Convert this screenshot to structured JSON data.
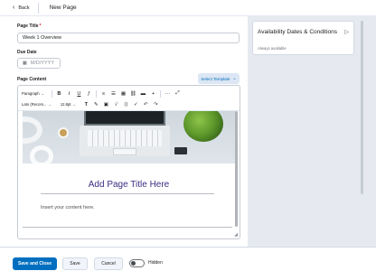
{
  "topbar": {
    "back_label": "Back",
    "back_icon": "chevron-left-icon",
    "page_title": "New Page"
  },
  "form": {
    "title_label": "Page Title",
    "title_required_mark": "*",
    "title_value": "Week 1 Overview",
    "due_label": "Due Date",
    "due_placeholder": "M/D/YYYY",
    "content_label": "Page Content",
    "template_button": "Select Template"
  },
  "toolbar": {
    "paragraph": "Paragraph",
    "font": "Lato (Recom...",
    "size": "12.8pt",
    "icons": [
      "bold-icon",
      "italic-icon",
      "underline-icon",
      "strikethrough-icon",
      "align-icon",
      "list-icon",
      "table-icon",
      "link-icon",
      "media-icon",
      "insert-icon",
      "more-icon",
      "fullscreen-icon",
      "text-color-icon",
      "highlight-icon",
      "image-icon",
      "equation-icon",
      "code-icon",
      "accessibility-icon",
      "undo-icon",
      "redo-icon"
    ]
  },
  "editor": {
    "heading": "Add Page Title Here",
    "body": "Insert your content here."
  },
  "sidebar": {
    "availability_title": "Availability Dates & Conditions",
    "availability_sub": "Always available"
  },
  "footer": {
    "save_close": "Save and Close",
    "save": "Save",
    "cancel": "Cancel",
    "hidden_label": "Hidden"
  },
  "colors": {
    "primary": "#006fbf",
    "heading": "#3e2c83",
    "sidebar_bg": "#e6eaf0"
  }
}
